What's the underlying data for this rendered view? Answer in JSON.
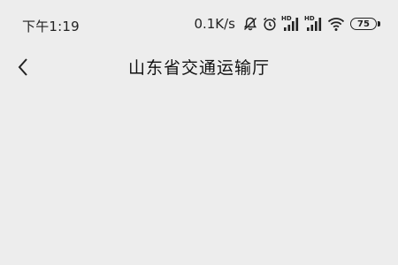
{
  "status_bar": {
    "time": "下午1:19",
    "net_speed": "0.1K/s",
    "signal_1_label": "HD",
    "signal_2_label": "HD",
    "battery": "75",
    "icons": [
      "bell-off-icon",
      "alarm-icon",
      "signal-hd-1-icon",
      "signal-hd-2-icon",
      "wifi-icon",
      "battery-icon"
    ]
  },
  "nav": {
    "back_icon": "chevron-left-icon",
    "title": "山东省交通运输厅"
  },
  "colors": {
    "background": "#ededed",
    "text": "#111111"
  }
}
